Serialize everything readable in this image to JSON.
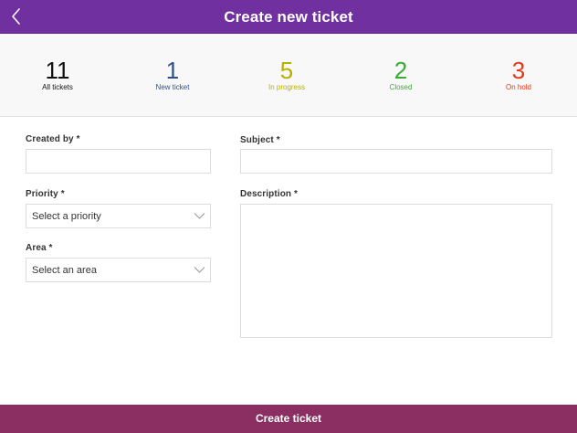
{
  "header": {
    "title": "Create new ticket",
    "back_icon": "chevron-left-icon"
  },
  "stats": [
    {
      "count": "11",
      "label": "All tickets",
      "color": "#111111"
    },
    {
      "count": "1",
      "label": "New ticket",
      "color": "#2f4f8f"
    },
    {
      "count": "5",
      "label": "In progress",
      "color": "#b8b000"
    },
    {
      "count": "2",
      "label": "Closed",
      "color": "#3aaa35"
    },
    {
      "count": "3",
      "label": "On hold",
      "color": "#e03a1e"
    }
  ],
  "form": {
    "created_by": {
      "label": "Created by *",
      "value": "",
      "placeholder": ""
    },
    "priority": {
      "label": "Priority *",
      "value": "Select a priority"
    },
    "area": {
      "label": "Area *",
      "value": "Select an area"
    },
    "subject": {
      "label": "Subject *",
      "value": "",
      "placeholder": ""
    },
    "description": {
      "label": "Description *",
      "value": "",
      "placeholder": ""
    }
  },
  "footer": {
    "create_label": "Create ticket"
  },
  "colors": {
    "header_bg": "#7030a0",
    "button_bg": "#8b2e62"
  }
}
